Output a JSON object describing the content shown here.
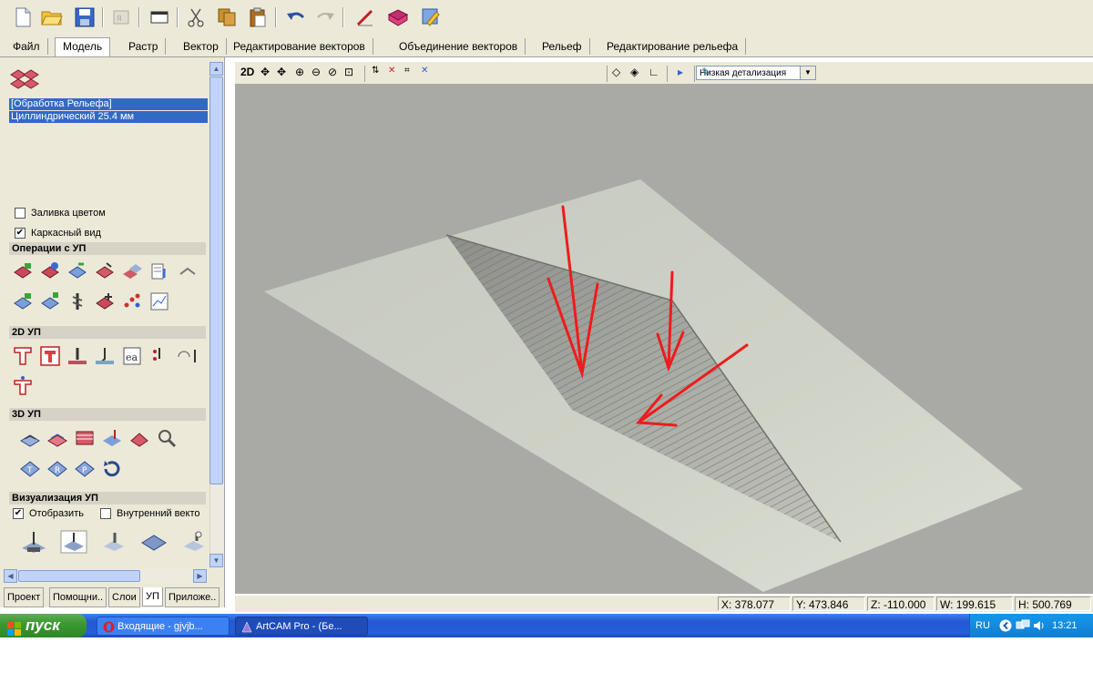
{
  "menu": {
    "tabs": [
      "Файл",
      "Модель",
      "Растр",
      "Вектор",
      "Редактирование векторов",
      "Объединение векторов",
      "Рельеф",
      "Редактирование рельефа"
    ],
    "active_index": 1
  },
  "panel": {
    "toolpath_group": "[Обработка Рельефа]",
    "toolpath_tool": "Циллиндрический 25.4 мм",
    "fill_color": "Заливка цветом",
    "wireframe": "Каркасный вид",
    "section_ops": "Операции с УП",
    "section_2d": "2D УП",
    "section_3d": "3D УП",
    "section_vis": "Визуализация УП",
    "show": "Отобразить",
    "inner_vector": "Внутренний векто",
    "wireframe_checked": true,
    "fill_color_checked": false,
    "show_checked": true
  },
  "bottom_tabs": [
    "Проект",
    "Помощни..",
    "Слои",
    "УП",
    "Приложе.."
  ],
  "bottom_active": 3,
  "view_toolbar": {
    "mode_2d": "2D",
    "detail_level": "Низкая детализация"
  },
  "status": {
    "x": "X: 378.077",
    "y": "Y: 473.846",
    "z": "Z: -110.000",
    "w": "W: 199.615",
    "h": "H: 500.769"
  },
  "taskbar": {
    "start": "пуск",
    "task1": "Входящие - gjvjb...",
    "task2": "ArtCAM Pro - (Бе...",
    "lang": "RU",
    "time": "13:21"
  },
  "colors": {
    "viewport_bg": "#a9aaa5",
    "arrow": "#ee1c1c",
    "selection": "#316ac5"
  }
}
